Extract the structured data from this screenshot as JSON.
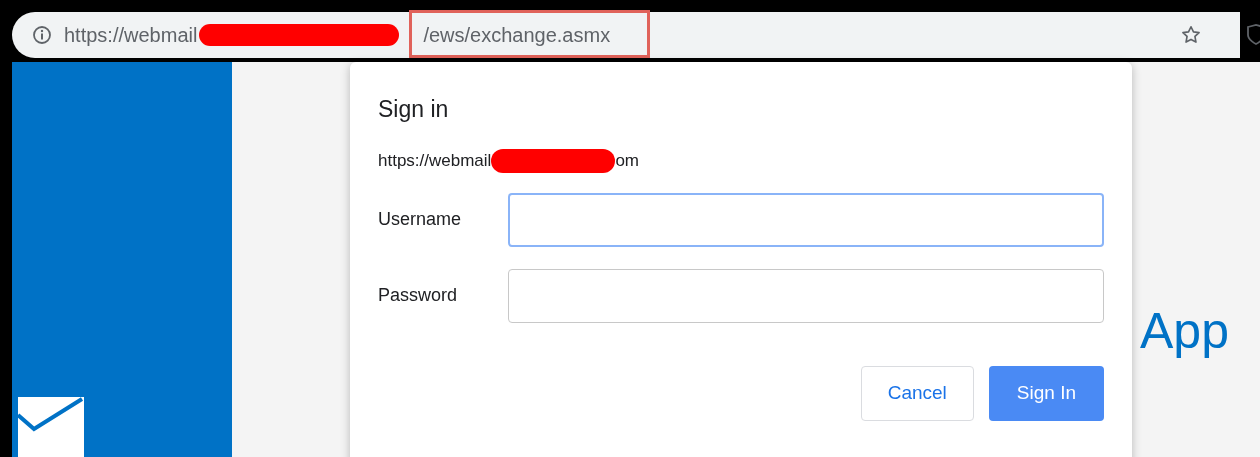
{
  "address_bar": {
    "url_start": "https://webmail",
    "url_end": "/ews/exchange.asmx",
    "highlighted": true
  },
  "page": {
    "heading": "App"
  },
  "dialog": {
    "title": "Sign in",
    "origin_start": "https://webmail",
    "origin_end": "om",
    "fields": [
      {
        "label": "Username",
        "focused": true
      },
      {
        "label": "Password",
        "focused": false
      }
    ],
    "buttons": [
      {
        "label": "Cancel",
        "kind": "secondary"
      },
      {
        "label": "Sign In",
        "kind": "primary"
      }
    ]
  }
}
